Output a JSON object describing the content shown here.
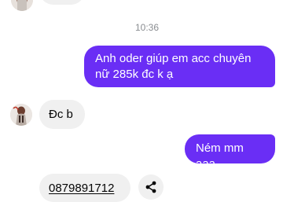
{
  "timestamp": "10:36",
  "messages": [
    {
      "direction": "incoming",
      "text": ""
    },
    {
      "direction": "outgoing",
      "text": "Anh oder giúp em acc chuyên nữ 285k đc k ạ"
    },
    {
      "direction": "incoming",
      "text": "Đc b"
    },
    {
      "direction": "outgoing",
      "text": "Ném mm aaa"
    },
    {
      "direction": "incoming",
      "text": "0879891712",
      "type": "phone-number"
    }
  ],
  "share_icon": "share-icon",
  "colors": {
    "outgoing_bubble": "#6a2ef5",
    "incoming_bubble": "#f0f0f0",
    "timestamp": "#8a8d91"
  }
}
